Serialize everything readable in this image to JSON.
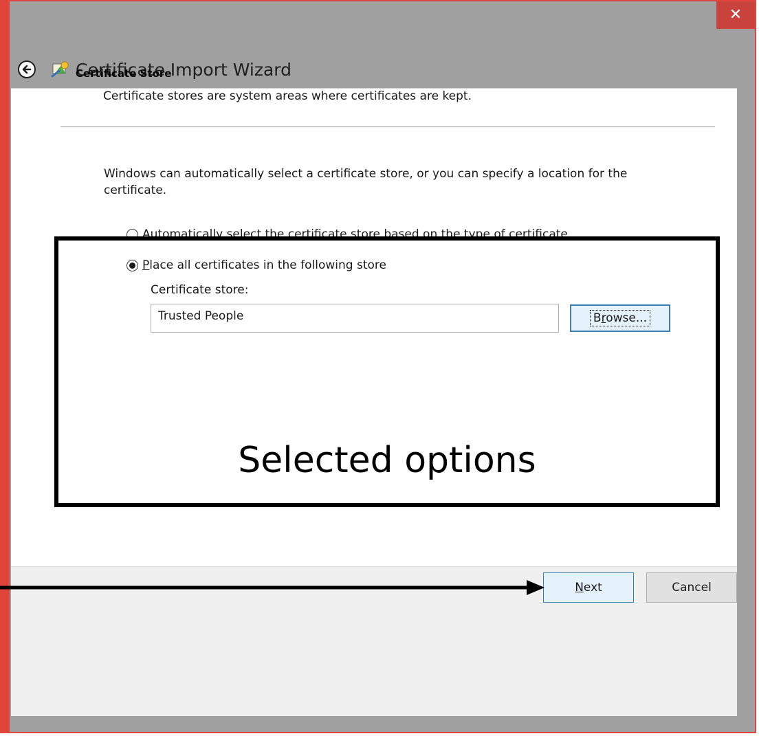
{
  "window": {
    "close_icon": "close-icon",
    "close_glyph": "✕",
    "frame_color": "#e0443a",
    "close_color": "#c9433c"
  },
  "header": {
    "back_icon": "back-arrow-icon",
    "wizard_icon": "certificate-wizard-icon",
    "title": "Certificate Import Wizard"
  },
  "section": {
    "title": "Certificate Store",
    "description": "Certificate stores are system areas where certificates are kept."
  },
  "options": {
    "intro": "Windows can automatically select a certificate store, or you can specify a location for the certificate.",
    "radio_auto": {
      "mnemonic_pre": "A",
      "mnemonic": "u",
      "rest": "tomatically select the certificate store based on the type of certificate",
      "checked": false
    },
    "radio_place": {
      "mnemonic": "P",
      "rest": "lace all certificates in the following store",
      "checked": true
    },
    "store_label": "Certificate store:",
    "store_value": "Trusted People",
    "browse": {
      "pre": "B",
      "mnemonic": "r",
      "rest": "owse..."
    }
  },
  "annotation": {
    "label": "Selected options"
  },
  "footer": {
    "next": {
      "mnemonic": "N",
      "rest": "ext"
    },
    "cancel_label": "Cancel"
  }
}
